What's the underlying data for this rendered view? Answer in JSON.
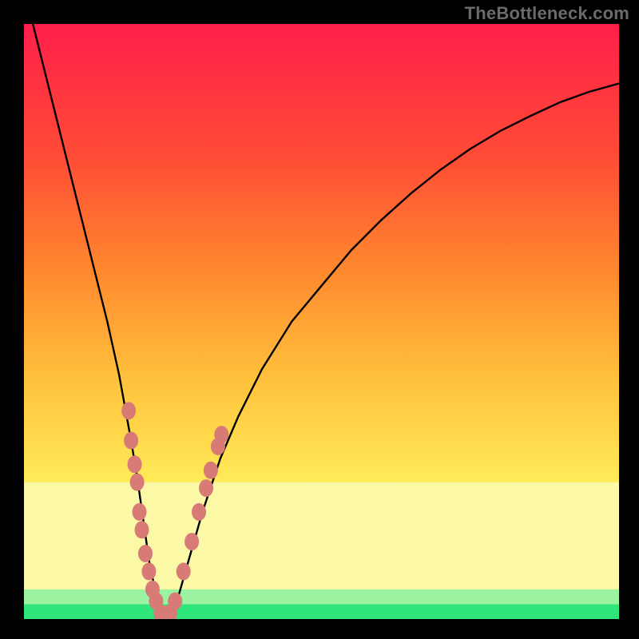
{
  "watermark": "TheBottleneck.com",
  "colors": {
    "frame": "#000000",
    "curve": "#000000",
    "markers": "#d87b77",
    "greenBand": "#2fe67a",
    "lightGreen": "#9bf2a1",
    "paleYellow": "#fbf8a6",
    "gradTop": "#ff1f4a",
    "gradMid1": "#ff6a2a",
    "gradMid2": "#ffb93a",
    "gradMid3": "#ffe956",
    "gradBottom": "#fbf89a"
  },
  "chart_data": {
    "type": "line",
    "title": "",
    "xlabel": "",
    "ylabel": "",
    "xlim": [
      0,
      100
    ],
    "ylim": [
      0,
      100
    ],
    "series": [
      {
        "name": "bottleneck-curve",
        "x": [
          0,
          2,
          4,
          6,
          8,
          10,
          12,
          14,
          16,
          18,
          19,
          20,
          21,
          22,
          23,
          24,
          25,
          26,
          28,
          30,
          33,
          36,
          40,
          45,
          50,
          55,
          60,
          65,
          70,
          75,
          80,
          85,
          90,
          95,
          100
        ],
        "y": [
          106,
          98,
          90,
          82,
          74,
          66,
          58,
          50,
          41,
          30,
          24,
          17,
          10,
          5,
          1,
          0,
          1,
          4,
          11,
          18,
          27,
          34,
          42,
          50,
          56,
          62,
          67,
          71.5,
          75.5,
          79,
          82,
          84.5,
          86.8,
          88.6,
          90
        ]
      }
    ],
    "markers": {
      "name": "highlighted-points",
      "points": [
        {
          "x": 17.6,
          "y": 35
        },
        {
          "x": 18.0,
          "y": 30
        },
        {
          "x": 18.6,
          "y": 26
        },
        {
          "x": 19.0,
          "y": 23
        },
        {
          "x": 19.4,
          "y": 18
        },
        {
          "x": 19.8,
          "y": 15
        },
        {
          "x": 20.4,
          "y": 11
        },
        {
          "x": 21.0,
          "y": 8
        },
        {
          "x": 21.6,
          "y": 5
        },
        {
          "x": 22.2,
          "y": 3
        },
        {
          "x": 23.0,
          "y": 1
        },
        {
          "x": 23.8,
          "y": 0
        },
        {
          "x": 24.6,
          "y": 1
        },
        {
          "x": 25.4,
          "y": 3
        },
        {
          "x": 26.8,
          "y": 8
        },
        {
          "x": 28.2,
          "y": 13
        },
        {
          "x": 29.4,
          "y": 18
        },
        {
          "x": 30.6,
          "y": 22
        },
        {
          "x": 31.4,
          "y": 25
        },
        {
          "x": 32.6,
          "y": 29
        },
        {
          "x": 33.2,
          "y": 31
        }
      ]
    },
    "bands": [
      {
        "name": "green-band",
        "y0": 0,
        "y1": 2.5,
        "color": "#2fe67a"
      },
      {
        "name": "light-green-band",
        "y0": 2.5,
        "y1": 5,
        "color": "#9bf2a1"
      },
      {
        "name": "pale-band",
        "y0": 5,
        "y1": 23,
        "color": "#fbf8a6"
      }
    ]
  }
}
